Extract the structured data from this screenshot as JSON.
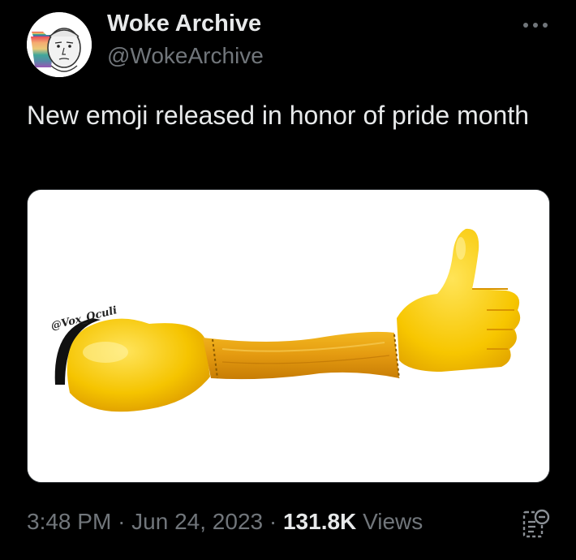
{
  "author": {
    "display_name": "Woke Archive",
    "handle": "@WokeArchive",
    "avatar_icon": "wojak-avatar-icon"
  },
  "tweet": {
    "text": "New emoji released in honor of pride month"
  },
  "media": {
    "watermark": "@Vox_Oculi",
    "image_icon": "thumbs-up-arm-emoji-image"
  },
  "meta": {
    "time": "3:48 PM",
    "date": "Jun 24, 2023",
    "separator": "·",
    "views_count": "131.8K",
    "views_label": "Views"
  },
  "icons": {
    "more": "more-horizontal-icon",
    "analytics": "bookmark-analytics-icon"
  },
  "colors": {
    "background": "#000000",
    "primary_text": "#e7e9ea",
    "secondary_text": "#71767b",
    "emoji_yellow": "#f5c400"
  }
}
